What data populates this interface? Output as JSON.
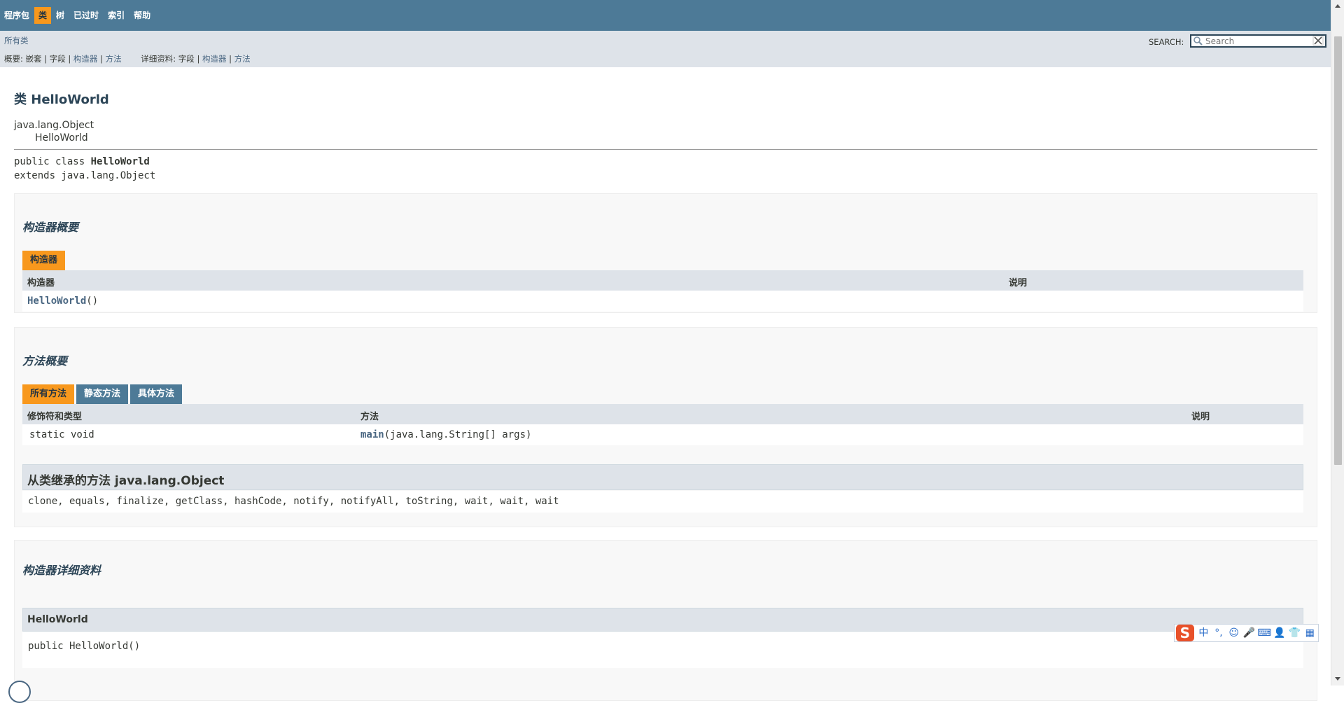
{
  "nav": {
    "items": [
      "程序包",
      "类",
      "树",
      "已过时",
      "索引",
      "帮助"
    ],
    "active_index": 1
  },
  "subnav": {
    "all_classes": "所有类",
    "summary_label": "概要:",
    "summary_nested": "嵌套",
    "summary_field": "字段",
    "summary_constructor": "构造器",
    "summary_method": "方法",
    "detail_label": "详细资料:",
    "detail_field": "字段",
    "detail_constructor": "构造器",
    "detail_method": "方法",
    "sep": "|",
    "search_label": "SEARCH:",
    "search_placeholder": "Search"
  },
  "header": {
    "title": "类 HelloWorld",
    "parent": "java.lang.Object",
    "child": "HelloWorld"
  },
  "signature": {
    "prefix": "public class ",
    "name": "HelloWorld",
    "extends": "extends java.lang.Object"
  },
  "constructor_summary": {
    "title": "构造器概要",
    "tab": "构造器",
    "col_constructor": "构造器",
    "col_desc": "说明",
    "rows": [
      {
        "name": "HelloWorld",
        "params": "()"
      }
    ]
  },
  "method_summary": {
    "title": "方法概要",
    "tabs": [
      "所有方法",
      "静态方法",
      "具体方法"
    ],
    "active_tab": 0,
    "col_modifier": "修饰符和类型",
    "col_method": "方法",
    "col_desc": "说明",
    "rows": [
      {
        "modifier": "static void",
        "name": "main",
        "params": "(java.lang.String[] args)"
      }
    ],
    "inherited_title": "从类继承的方法 java.lang.Object",
    "inherited_list": "clone, equals, finalize, getClass, hashCode, notify, notifyAll, toString, wait, wait, wait"
  },
  "constructor_detail": {
    "title": "构造器详细资料",
    "name": "HelloWorld",
    "signature": "public HelloWorld()"
  },
  "ime": {
    "logo": "S",
    "lang": "中",
    "punct": "°,",
    "emoji": "☺",
    "mic": "🎤",
    "keyboard": "⌨",
    "user": "👤",
    "skin": "👕",
    "grid": "▦"
  }
}
